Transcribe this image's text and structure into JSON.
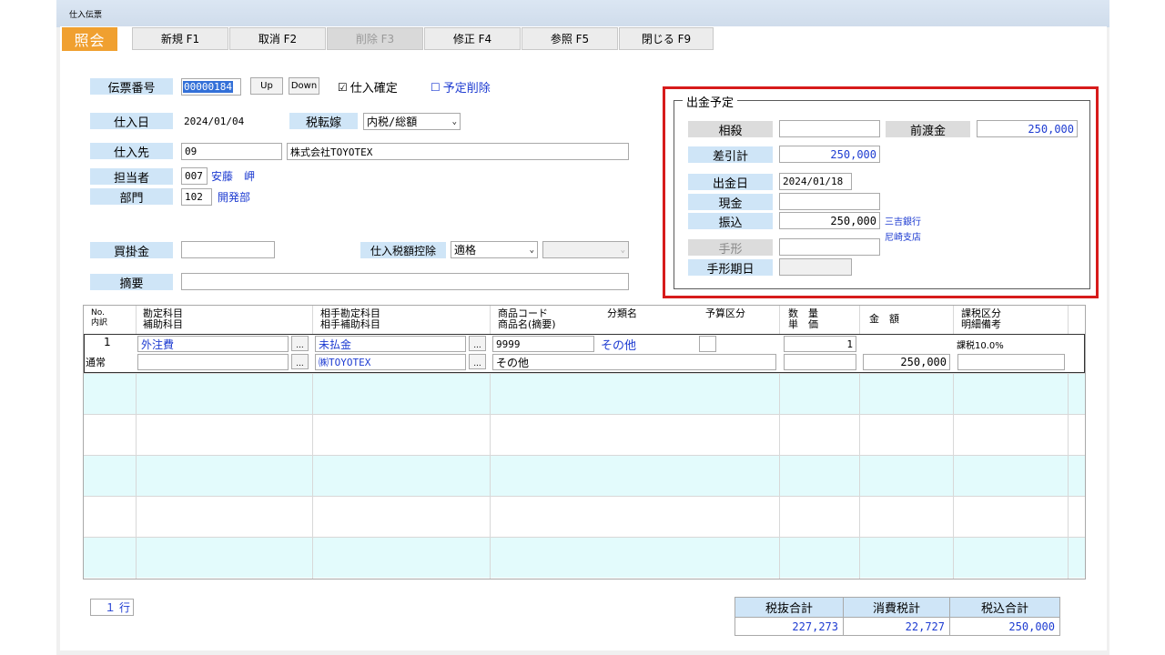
{
  "window": {
    "title": "仕入伝票"
  },
  "mode_label": "照会",
  "toolbar": [
    {
      "label": "新規 F1",
      "disabled": false
    },
    {
      "label": "取消 F2",
      "disabled": false
    },
    {
      "label": "削除 F3",
      "disabled": true
    },
    {
      "label": "修正 F4",
      "disabled": false
    },
    {
      "label": "参照 F5",
      "disabled": false
    },
    {
      "label": "閉じる F9",
      "disabled": false
    }
  ],
  "header": {
    "voucher_no_label": "伝票番号",
    "voucher_no": "00000184",
    "up_label": "Up",
    "down_label": "Down",
    "purchase_confirm_label": "仕入確定",
    "purchase_confirm_checked": true,
    "planned_delete_label": "予定削除",
    "planned_delete_checked": false,
    "purchase_date_label": "仕入日",
    "purchase_date": "2024/01/04",
    "tax_transfer_label": "税転嫁",
    "tax_transfer_value": "内税/総額",
    "supplier_label": "仕入先",
    "supplier_code": "09",
    "supplier_name": "株式会社TOYOTEX",
    "staff_label": "担当者",
    "staff_code": "007",
    "staff_name": "安藤　岬",
    "dept_label": "部門",
    "dept_code": "102",
    "dept_name": "開発部",
    "payable_label": "買掛金",
    "payable_value": "",
    "tax_deduct_label": "仕入税額控除",
    "tax_deduct_value": "適格",
    "tax_deduct_value2": "",
    "memo_label": "摘要",
    "memo_value": ""
  },
  "payment": {
    "group_title": "出金予定",
    "offset_label": "相殺",
    "offset_value": "",
    "advance_label": "前渡金",
    "advance_value": "250,000",
    "net_label": "差引計",
    "net_value": "250,000",
    "date_label": "出金日",
    "date_value": "2024/01/18",
    "cash_label": "現金",
    "cash_value": "",
    "transfer_label": "振込",
    "transfer_value": "250,000",
    "bank_name": "三吉銀行",
    "branch_name": "尼崎支店",
    "bill_label": "手形",
    "bill_value": "",
    "bill_due_label": "手形期日",
    "bill_due_value": ""
  },
  "grid": {
    "headers": {
      "no1": "No.",
      "no2": "内訳",
      "acct1": "勘定科目",
      "acct2": "補助科目",
      "contra1": "相手勘定科目",
      "contra2": "相手補助科目",
      "item1": "商品コード",
      "item2": "商品名(摘要)",
      "category": "分類名",
      "budget": "予算区分",
      "qty1": "数　量",
      "qty2": "単　価",
      "amount": "金　額",
      "tax1": "課税区分",
      "tax2": "明細備考"
    },
    "row": {
      "no": "1",
      "type": "通常",
      "account": "外注費",
      "sub_account": "",
      "contra_account": "未払金",
      "contra_sub": "㈱TOYOTEX",
      "item_code": "9999",
      "category": "その他",
      "item_name": "その他",
      "budget": "",
      "qty": "1",
      "unit_price": "",
      "amount": "250,000",
      "tax_class": "課税10.0%",
      "note": ""
    },
    "ellipsis": "..."
  },
  "footer": {
    "row_count": "１ 行",
    "subtotal_label": "税抜合計",
    "tax_label": "消費税計",
    "total_label": "税込合計",
    "subtotal": "227,273",
    "tax": "22,727",
    "total": "250,000"
  }
}
